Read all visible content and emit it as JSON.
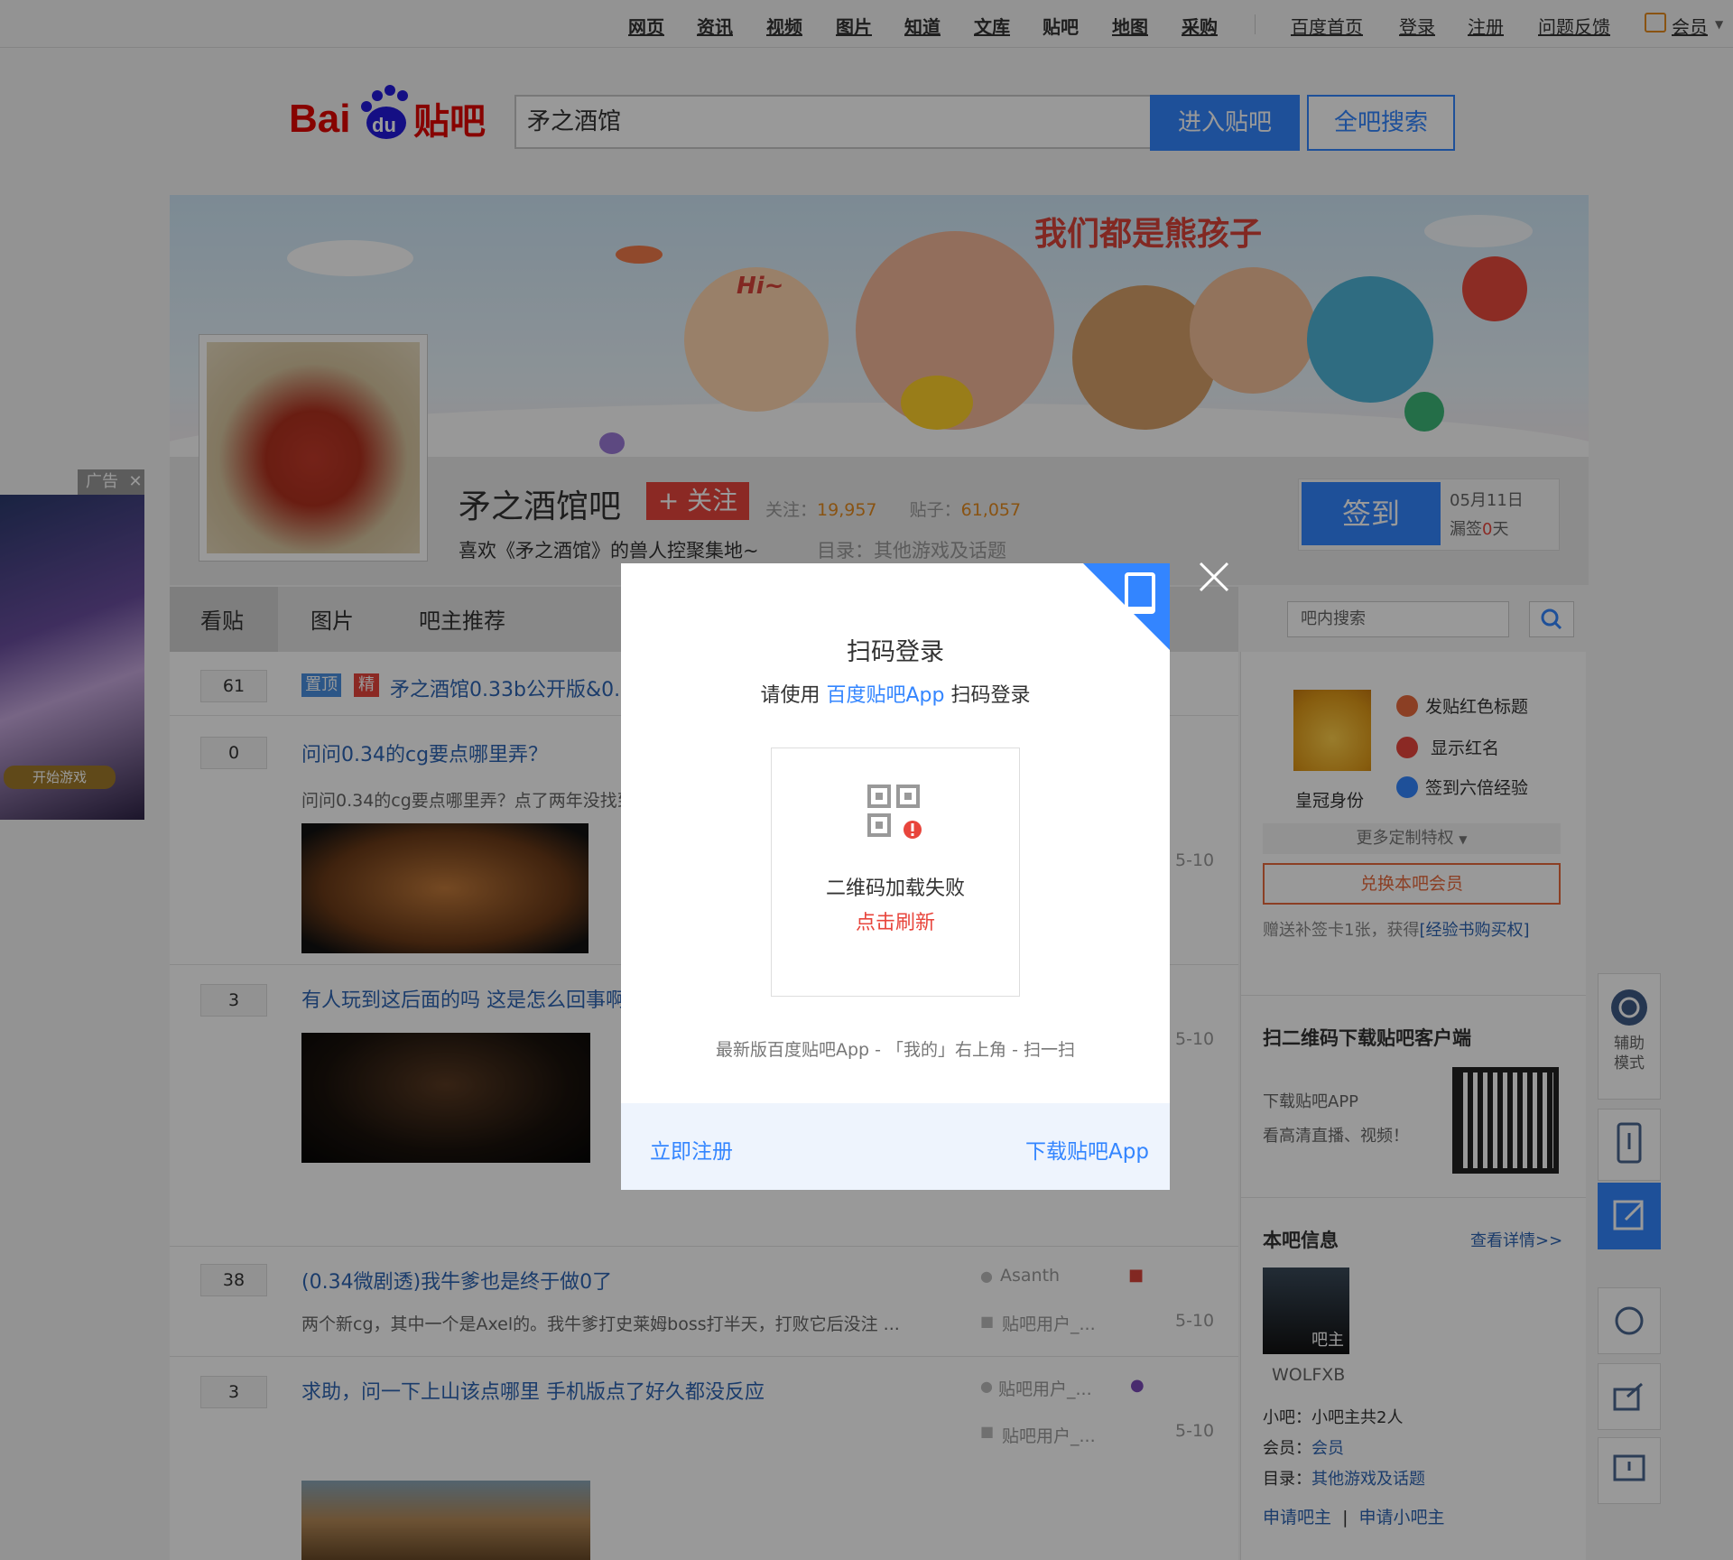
{
  "topnav": {
    "links": [
      "网页",
      "资讯",
      "视频",
      "图片",
      "知道",
      "文库",
      "贴吧",
      "地图",
      "采购"
    ],
    "right_links": [
      "百度首页",
      "登录",
      "注册",
      "问题反馈"
    ],
    "member": "会员"
  },
  "search": {
    "value": "矛之酒馆",
    "enter_label": "进入贴吧",
    "all_label": "全吧搜索"
  },
  "banner": {
    "text": "我们都是熊孩子",
    "hi": "Hi~"
  },
  "forum": {
    "name": "矛之酒馆吧",
    "follow_label": "+ 关注",
    "follow_caption": "关注：",
    "follow_count": "19,957",
    "posts_caption": "贴子：",
    "posts_count": "61,057",
    "slogan": "喜欢《矛之酒馆》的兽人控聚集地~",
    "catalog_caption": "目录：",
    "catalog": "其他游戏及话题",
    "signin_label": "签到",
    "sign_date": "05月11日",
    "sign_miss_prefix": "漏签",
    "sign_miss_days": "0",
    "sign_miss_suffix": "天"
  },
  "tabs": [
    "看贴",
    "图片",
    "吧主推荐"
  ],
  "inforum_search_placeholder": "吧内搜索",
  "threads": [
    {
      "count": "61",
      "tag_top": "置顶",
      "tag_good": "精",
      "title": "矛之酒馆0.33b公开版&0.3"
    },
    {
      "count": "0",
      "title": "问问0.34的cg要点哪里弄？",
      "abstract": "问问0.34的cg要点哪里弄？点了两年没找到",
      "date": "5-10"
    },
    {
      "count": "3",
      "title": "有人玩到这后面的吗 这是怎么回事啊",
      "date": "5-10"
    },
    {
      "count": "38",
      "title": "(0.34微剧透)我牛爹也是终于做0了",
      "abstract": "两个新cg，其中一个是Axel的。我牛爹打史莱姆boss打半天，打败它后没注 ...",
      "author": "Asanth",
      "last_reply": "贴吧用户_...",
      "date": "5-10"
    },
    {
      "count": "3",
      "title": "求助，问一下上山该点哪里 手机版点了好久都没反应",
      "author": "贴吧用户_...",
      "last_reply": "贴吧用户_...",
      "date": "5-10"
    }
  ],
  "sidebar": {
    "crown": "皇冠身份",
    "perks": [
      "发贴红色标题",
      "显示红名",
      "签到六倍经验"
    ],
    "more": "更多定制特权",
    "exchange": "兑换本吧会员",
    "gift_prefix": "赠送补签卡1张，获得",
    "gift_link": "[经验书购买权]",
    "qr_title": "扫二维码下载贴吧客户端",
    "qr_line1": "下载贴吧APP",
    "qr_line2": "看高清直播、视频！",
    "info_title": "本吧信息",
    "info_more": "查看详情>>",
    "owner_badge": "吧主",
    "owner_name": "WOLFXB",
    "small_owner": "小吧：小吧主共2人",
    "member_caption": "会员：",
    "member_value": "会员",
    "catalog_caption": "目录：",
    "catalog_value": "其他游戏及话题",
    "apply_owner": "申请吧主",
    "apply_small": "申请小吧主"
  },
  "ad": {
    "label": "广告",
    "close": "✕",
    "game_btn": "开始游戏"
  },
  "float_tools": {
    "assist": "辅助\n模式"
  },
  "modal": {
    "title": "扫码登录",
    "sub_prefix": "请使用 ",
    "sub_app": "百度贴吧App",
    "sub_suffix": " 扫码登录",
    "fail": "二维码加载失败",
    "refresh": "点击刷新",
    "hint": "最新版百度贴吧App - 「我的」右上角 - 扫一扫",
    "register": "立即注册",
    "download": "下载贴吧App"
  },
  "colors": {
    "accent": "#3385ff",
    "red": "#e8453c",
    "orange": "#e58a1f"
  }
}
